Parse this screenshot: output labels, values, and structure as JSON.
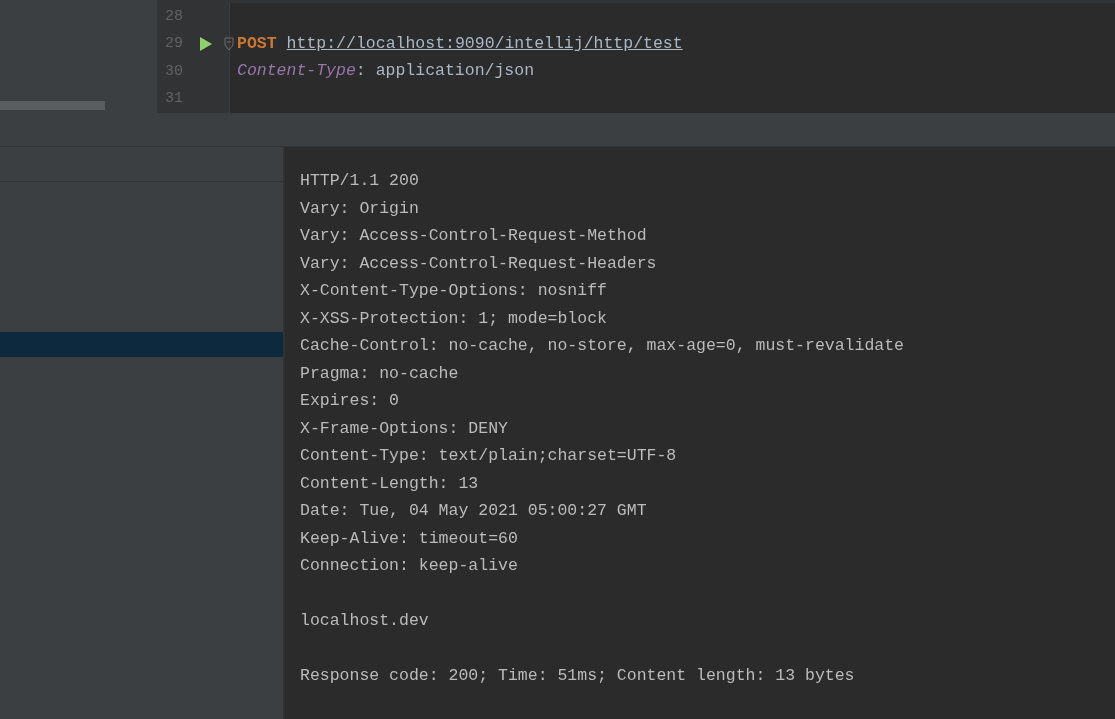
{
  "editor": {
    "lines": [
      {
        "number": "28"
      },
      {
        "number": "29",
        "run": true,
        "fold": true,
        "tokens": [
          {
            "kind": "method",
            "text": "POST"
          },
          {
            "kind": "url",
            "text": "http://localhost:9090/intellij/http/test"
          }
        ]
      },
      {
        "number": "30",
        "tokens": [
          {
            "kind": "header-name",
            "text": "Content-Type"
          },
          {
            "kind": "plain",
            "text": ": application/json"
          }
        ]
      },
      {
        "number": "31"
      }
    ]
  },
  "history": {
    "rows": [
      {
        "selected": true
      }
    ]
  },
  "response": {
    "headers": [
      "HTTP/1.1 200",
      "Vary: Origin",
      "Vary: Access-Control-Request-Method",
      "Vary: Access-Control-Request-Headers",
      "X-Content-Type-Options: nosniff",
      "X-XSS-Protection: 1; mode=block",
      "Cache-Control: no-cache, no-store, max-age=0, must-revalidate",
      "Pragma: no-cache",
      "Expires: 0",
      "X-Frame-Options: DENY",
      "Content-Type: text/plain;charset=UTF-8",
      "Content-Length: 13",
      "Date: Tue, 04 May 2021 05:00:27 GMT",
      "Keep-Alive: timeout=60",
      "Connection: keep-alive"
    ],
    "body": "localhost.dev",
    "summary": "Response code: 200; Time: 51ms; Content length: 13 bytes"
  }
}
